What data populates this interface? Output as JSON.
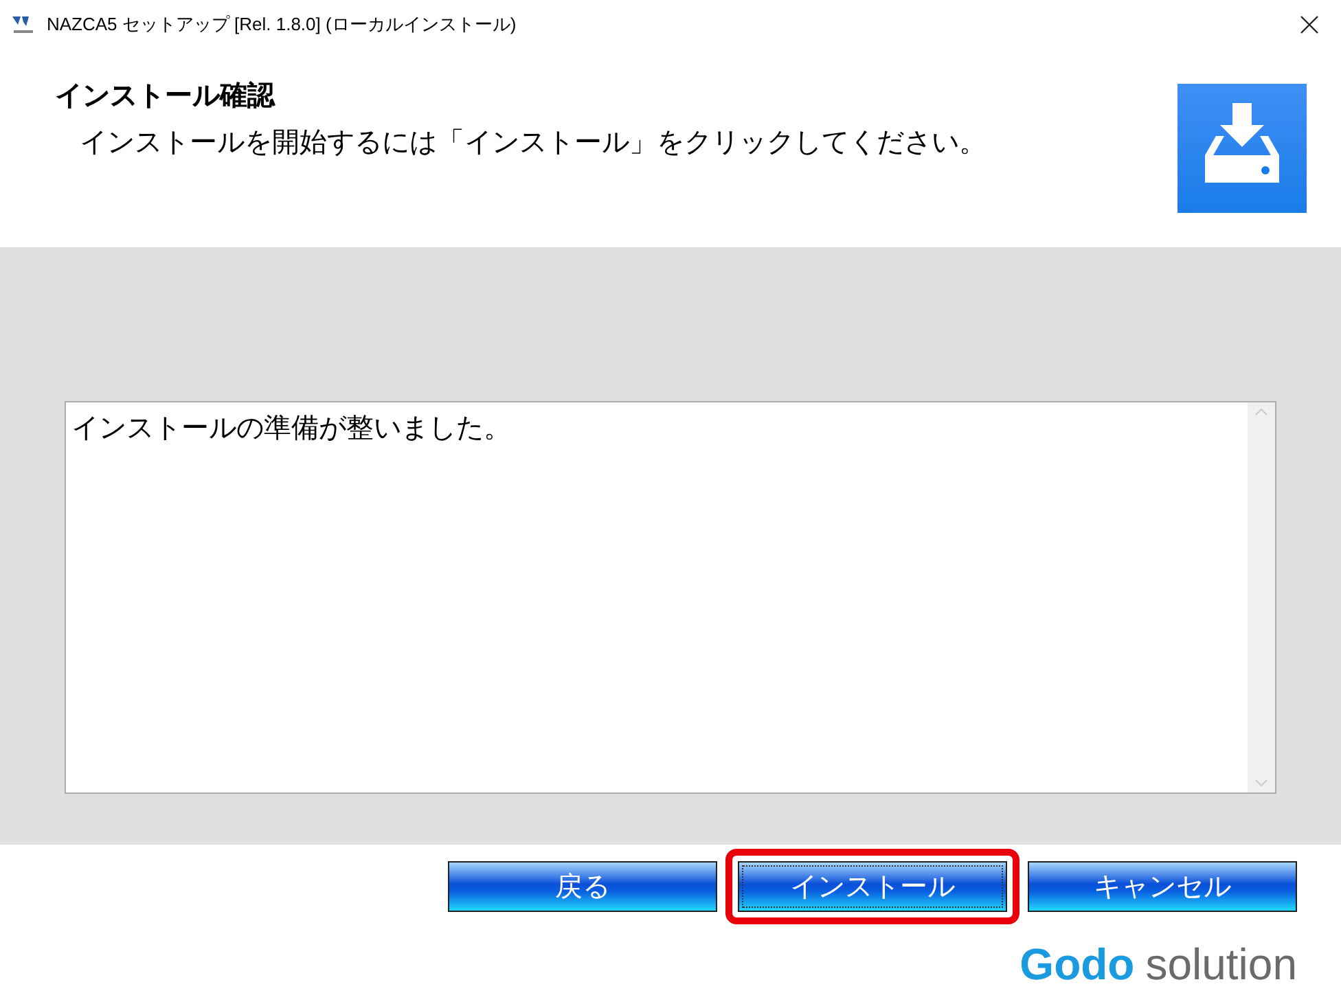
{
  "window": {
    "title": "NAZCA5 セットアップ [Rel. 1.8.0] (ローカルインストール)"
  },
  "header": {
    "title": "インストール確認",
    "subtitle": "インストールを開始するには「インストール」をクリックしてください。"
  },
  "message_box": {
    "text": "インストールの準備が整いました。"
  },
  "buttons": [
    {
      "label": "戻る",
      "focused": false,
      "highlighted": false
    },
    {
      "label": "インストール",
      "focused": true,
      "highlighted": true
    },
    {
      "label": "キャンセル",
      "focused": false,
      "highlighted": false
    }
  ],
  "logo": {
    "brand": "Godo",
    "suffix": "solution"
  }
}
